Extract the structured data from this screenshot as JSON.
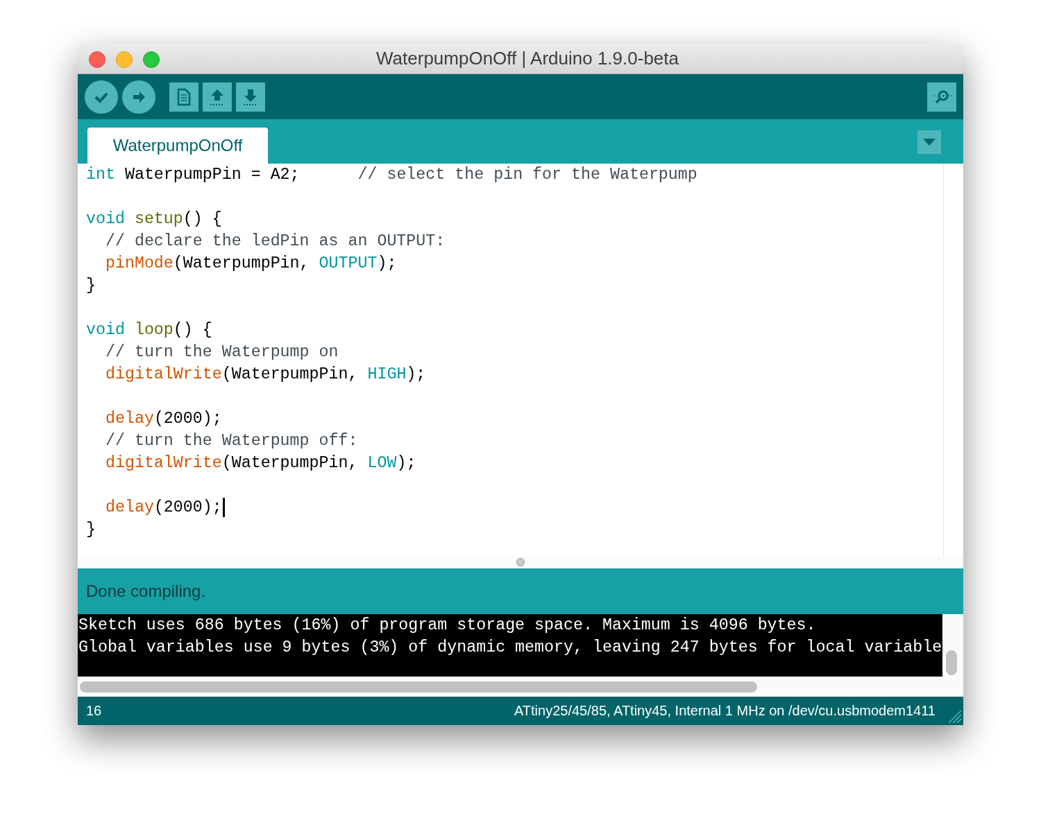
{
  "window": {
    "title": "WaterpumpOnOff | Arduino 1.9.0-beta"
  },
  "tabs": [
    {
      "label": "WaterpumpOnOff",
      "selected": true
    }
  ],
  "code": [
    {
      "kind": "code",
      "cursor": false,
      "tokens": [
        {
          "kind": "type",
          "text": "int"
        },
        {
          "kind": "plain",
          "text": " WaterpumpPin = A2;      "
        },
        {
          "kind": "comment",
          "text": "// select the pin for the Waterpump"
        }
      ]
    },
    {
      "kind": "blank",
      "cursor": false
    },
    {
      "kind": "code",
      "cursor": false,
      "tokens": [
        {
          "kind": "type",
          "text": "void "
        },
        {
          "kind": "function",
          "text": "setup"
        },
        {
          "kind": "plain",
          "text": "() {"
        }
      ]
    },
    {
      "kind": "code",
      "cursor": false,
      "tokens": [
        {
          "kind": "comment",
          "text": "  // declare the ledPin as an OUTPUT:"
        }
      ]
    },
    {
      "kind": "code",
      "cursor": false,
      "tokens": [
        {
          "kind": "builtin",
          "text": "  pinMode"
        },
        {
          "kind": "plain",
          "text": "(WaterpumpPin, "
        },
        {
          "kind": "type",
          "text": "OUTPUT"
        },
        {
          "kind": "plain",
          "text": ");"
        }
      ]
    },
    {
      "kind": "code",
      "cursor": false,
      "tokens": [
        {
          "kind": "plain",
          "text": "}"
        }
      ]
    },
    {
      "kind": "blank",
      "cursor": false
    },
    {
      "kind": "code",
      "cursor": false,
      "tokens": [
        {
          "kind": "type",
          "text": "void "
        },
        {
          "kind": "function",
          "text": "loop"
        },
        {
          "kind": "plain",
          "text": "() {"
        }
      ]
    },
    {
      "kind": "code",
      "cursor": false,
      "tokens": [
        {
          "kind": "comment",
          "text": "  // turn the Waterpump on"
        }
      ]
    },
    {
      "kind": "code",
      "cursor": false,
      "tokens": [
        {
          "kind": "builtin",
          "text": "  digitalWrite"
        },
        {
          "kind": "plain",
          "text": "(WaterpumpPin, "
        },
        {
          "kind": "type",
          "text": "HIGH"
        },
        {
          "kind": "plain",
          "text": ");"
        }
      ]
    },
    {
      "kind": "blank",
      "cursor": false
    },
    {
      "kind": "code",
      "cursor": false,
      "tokens": [
        {
          "kind": "builtin",
          "text": "  delay"
        },
        {
          "kind": "plain",
          "text": "(2000);"
        }
      ]
    },
    {
      "kind": "code",
      "cursor": false,
      "tokens": [
        {
          "kind": "comment",
          "text": "  // turn the Waterpump off:"
        }
      ]
    },
    {
      "kind": "code",
      "cursor": false,
      "tokens": [
        {
          "kind": "builtin",
          "text": "  digitalWrite"
        },
        {
          "kind": "plain",
          "text": "(WaterpumpPin, "
        },
        {
          "kind": "type",
          "text": "LOW"
        },
        {
          "kind": "plain",
          "text": ");"
        }
      ]
    },
    {
      "kind": "blank",
      "cursor": false
    },
    {
      "kind": "code",
      "cursor": true,
      "tokens": [
        {
          "kind": "builtin",
          "text": "  delay"
        },
        {
          "kind": "plain",
          "text": "(2000);"
        }
      ]
    },
    {
      "kind": "code",
      "cursor": false,
      "tokens": [
        {
          "kind": "plain",
          "text": "}"
        }
      ]
    }
  ],
  "message": "Done compiling.",
  "console": [
    "Sketch uses 686 bytes (16%) of program storage space. Maximum is 4096 bytes.",
    "Global variables use 9 bytes (3%) of dynamic memory, leaving 247 bytes for local variable"
  ],
  "status_bar": {
    "line": "16",
    "board": "ATtiny25/45/85, ATtiny45, Internal 1 MHz on /dev/cu.usbmodem1411"
  }
}
